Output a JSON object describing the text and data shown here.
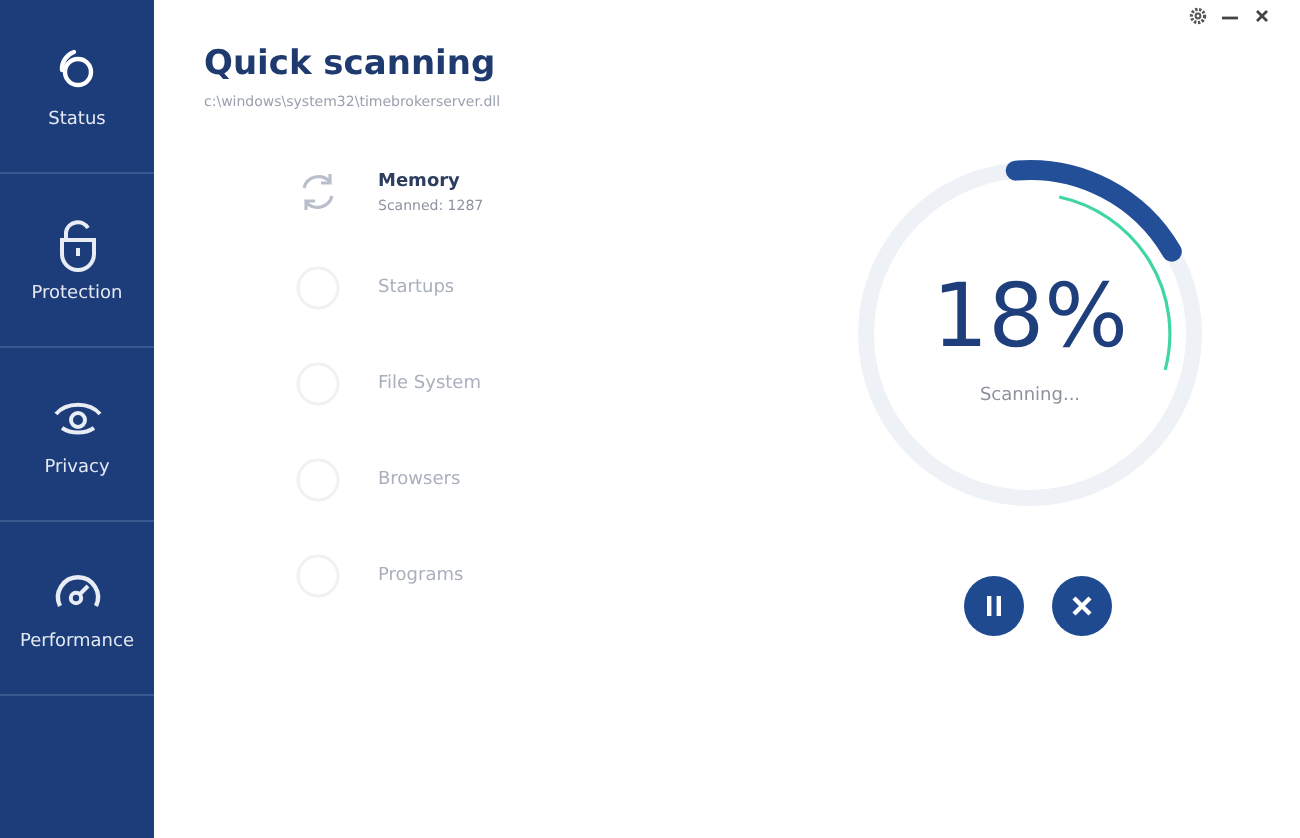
{
  "sidebar": {
    "items": [
      {
        "label": "Status"
      },
      {
        "label": "Protection"
      },
      {
        "label": "Privacy"
      },
      {
        "label": "Performance"
      }
    ]
  },
  "title": "Quick scanning",
  "path": "c:\\windows\\system32\\timebrokerserver.dll",
  "steps": [
    {
      "kind": "active",
      "label": "Memory",
      "status": "Scanned: 1287"
    },
    {
      "kind": "pending",
      "label": "Startups"
    },
    {
      "kind": "pending",
      "label": "File System"
    },
    {
      "kind": "pending",
      "label": "Browsers"
    },
    {
      "kind": "pending",
      "label": "Programs"
    }
  ],
  "progress": {
    "percent": "18%",
    "caption": "Scanning...",
    "level": 0.18
  }
}
